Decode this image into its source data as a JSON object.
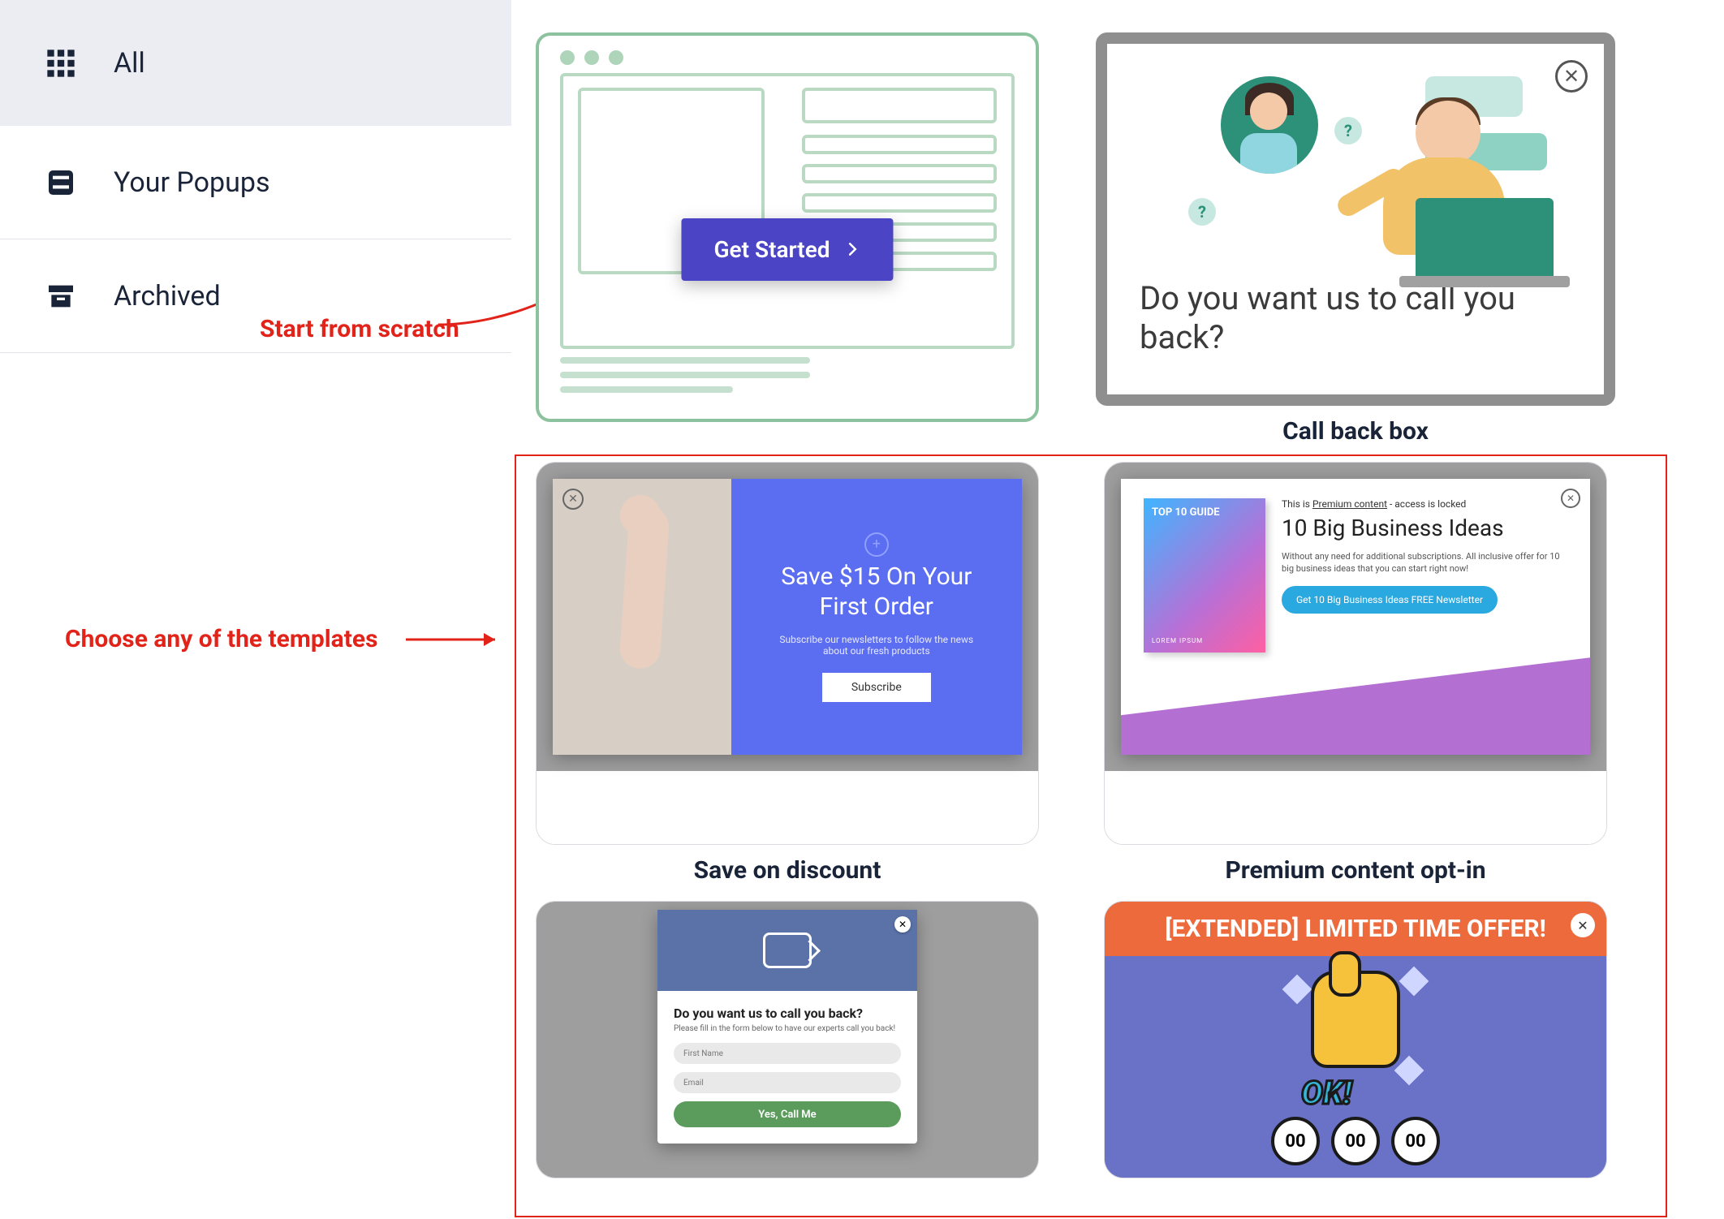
{
  "sidebar": {
    "items": [
      {
        "label": "All"
      },
      {
        "label": "Your Popups"
      },
      {
        "label": "Archived"
      }
    ]
  },
  "annotations": {
    "start_from_scratch": "Start from scratch",
    "choose_templates": "Choose any of the templates"
  },
  "cards": {
    "get_started": {
      "button": "Get Started"
    },
    "callback": {
      "title": "Call back box",
      "headline": "Do you want us to call you back?"
    },
    "save_discount": {
      "title": "Save on discount",
      "heading": "Save $15 On Your First Order",
      "sub": "Subscribe our newsletters to follow the news about our fresh products",
      "button": "Subscribe"
    },
    "premium": {
      "title": "Premium content opt-in",
      "book_label": "TOP 10 GUIDE",
      "book_sub": "LOREM IPSUM",
      "meta_prefix": "This is ",
      "meta_link": "Premium content",
      "meta_suffix": " - access is locked",
      "heading": "10 Big Business Ideas",
      "desc": "Without any need for additional subscriptions. All inclusive offer for 10 big business ideas that you can start right now!",
      "button": "Get 10 Big Business Ideas FREE Newsletter"
    },
    "callback_form": {
      "heading": "Do you want us to call you back?",
      "sub": "Please fill in the form below to have our experts call you back!",
      "field1": "First Name",
      "field2": "Email",
      "button": "Yes, Call Me"
    },
    "limited_offer": {
      "banner": "[EXTENDED] LIMITED TIME OFFER!",
      "ok": "OK!",
      "timer": "00"
    }
  }
}
